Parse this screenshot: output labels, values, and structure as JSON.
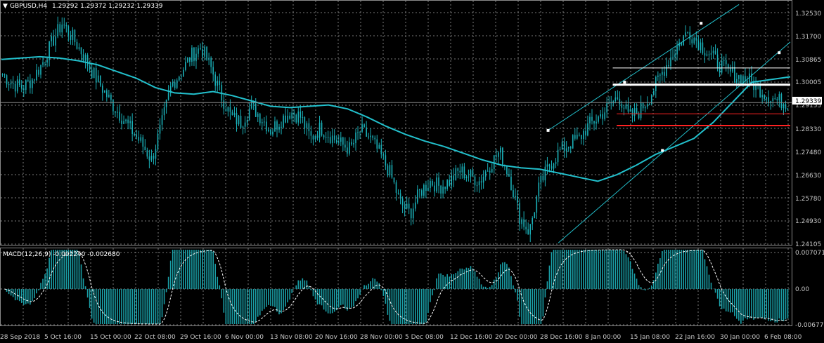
{
  "chart_header": {
    "symbol_label": "GBPUSD,H4",
    "ohlc": "1.29292 1.29372 1.29232 1.29339"
  },
  "macd_header": {
    "label": "MACD(12,26,9) -0.002240 -0.002680"
  },
  "colors": {
    "background": "#000000",
    "grid": "#7a7a7a",
    "candles": "#1ab0b8",
    "moving_average": "#22c0cc",
    "channel": "#22c0cc",
    "resistance_line": "#ffffff",
    "support_lines": "#ff2222",
    "macd_histogram": "#1aa0a8",
    "macd_signal": "#ffffff",
    "current_price_box": "#ffffff"
  },
  "price_axis": {
    "ticks": [
      "1.32530",
      "1.31700",
      "1.30865",
      "1.30005",
      "1.29155",
      "1.28330",
      "1.27480",
      "1.26630",
      "1.25780",
      "1.24930",
      "1.24105"
    ],
    "current_price": "1.29339"
  },
  "macd_axis": {
    "ticks": [
      "0.007071",
      "0.00",
      "-0.006772"
    ]
  },
  "time_axis": {
    "labels": [
      "28 Sep 2018",
      "5 Oct 16:00",
      "15 Oct 00:00",
      "22 Oct 08:00",
      "29 Oct 16:00",
      "6 Nov 00:00",
      "13 Nov 08:00",
      "20 Nov 16:00",
      "28 Nov 00:00",
      "5 Dec 08:00",
      "12 Dec 16:00",
      "20 Dec 00:00",
      "28 Dec 16:00",
      "8 Jan 00:00",
      "15 Jan 08:00",
      "22 Jan 16:00",
      "30 Jan 00:00",
      "6 Feb 08:00"
    ]
  },
  "chart_data": {
    "type": "candlestick",
    "symbol": "GBPUSD",
    "timeframe": "H4",
    "ylim": [
      1.24105,
      1.3296
    ],
    "close_path": [
      1.304,
      1.3005,
      1.299,
      1.302,
      1.308,
      1.316,
      1.323,
      1.318,
      1.312,
      1.305,
      1.299,
      1.293,
      1.288,
      1.283,
      1.278,
      1.272,
      1.285,
      1.3,
      1.305,
      1.311,
      1.314,
      1.306,
      1.296,
      1.288,
      1.286,
      1.292,
      1.288,
      1.283,
      1.287,
      1.29,
      1.288,
      1.28,
      1.284,
      1.281,
      1.278,
      1.276,
      1.283,
      1.28,
      1.274,
      1.267,
      1.256,
      1.252,
      1.26,
      1.264,
      1.262,
      1.264,
      1.268,
      1.266,
      1.264,
      1.27,
      1.275,
      1.266,
      1.251,
      1.245,
      1.262,
      1.27,
      1.275,
      1.278,
      1.28,
      1.285,
      1.288,
      1.292,
      1.296,
      1.288,
      1.29,
      1.295,
      1.302,
      1.309,
      1.315,
      1.32,
      1.316,
      1.312,
      1.308,
      1.305,
      1.303,
      1.302,
      1.299,
      1.296,
      1.294,
      1.2934
    ],
    "moving_average": [
      1.3095,
      1.31,
      1.3105,
      1.31,
      1.309,
      1.3075,
      1.305,
      1.3025,
      1.299,
      1.297,
      1.2965,
      1.2975,
      1.296,
      1.294,
      1.292,
      1.2915,
      1.292,
      1.2925,
      1.291,
      1.288,
      1.2845,
      1.2815,
      1.279,
      1.277,
      1.2745,
      1.272,
      1.27,
      1.269,
      1.2685,
      1.267,
      1.2655,
      1.264,
      1.2665,
      1.27,
      1.274,
      1.277,
      1.28,
      1.286,
      1.2935,
      1.301,
      1.302,
      1.303
    ],
    "channel_lines": [
      {
        "from": [
          "28 Dec",
          1.241
        ],
        "to": [
          "6 Feb",
          1.314
        ]
      },
      {
        "from": [
          "28 Dec",
          1.282
        ],
        "to": [
          "30 Jan",
          1.333
        ]
      }
    ],
    "horizontal_levels": [
      {
        "price": 1.30005,
        "color": "white"
      },
      {
        "price": 1.3063,
        "color": "white"
      },
      {
        "price": 1.2892,
        "color": "red"
      },
      {
        "price": 1.2848,
        "color": "red"
      }
    ],
    "current_price": 1.29339,
    "macd": {
      "params": "12,26,9",
      "main": -0.00224,
      "signal": -0.00268,
      "ylim": [
        -0.006772,
        0.007071
      ]
    }
  }
}
